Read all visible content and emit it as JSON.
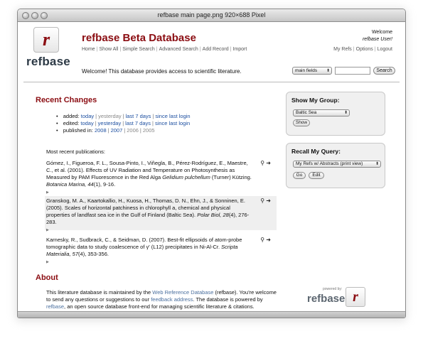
{
  "window": {
    "title": "refbase main page.png 920×688 Pixel"
  },
  "brand": {
    "logo_letter": "r",
    "logo_word": "refbase",
    "app_title": "refbase Beta Database"
  },
  "topnav": [
    "Home",
    "Show All",
    "Simple Search",
    "Advanced Search",
    "Add Record",
    "Import"
  ],
  "user": {
    "welcome": "Welcome",
    "name": "refbase User!",
    "nav": [
      "My Refs",
      "Options",
      "Logout"
    ]
  },
  "welcome_message": "Welcome! This database provides access to scientific literature.",
  "search": {
    "field_select": "main fields",
    "query": "",
    "button": "Search"
  },
  "recent_changes": {
    "heading": "Recent Changes",
    "added_label": "added:",
    "edited_label": "edited:",
    "published_label": "published in:",
    "today": "today",
    "yesterday": "yesterday",
    "last7": "last 7 days",
    "since_login": "since last login",
    "years": [
      "2008",
      "2007",
      "2006",
      "2005"
    ]
  },
  "publications": {
    "heading": "Most recent publications:",
    "items": [
      {
        "authors": "Gómez, I., Figueroa, F. L., Sousa-Pinto, I., Viñegla, B., Pérez-Rodríguez, E., Maestre, C., et al. (2001). Effects of UV Radiation and Temperature on Photosynthesis as Measured by PAM Fluorescence in the Red Alga ",
        "species": "Gelidium pulchellum",
        "rest": " (Turner) Kützing. ",
        "journal": "Botanica Marina, 44",
        "pages": "(1), 9-16."
      },
      {
        "authors": "Granskog, M. A., Kaartokallio, H., Kuosa, H., Thomas, D. N., Ehn, J., & Sonninen, E. (2005). Scales of horizontal patchiness in chlorophyll a, chemical and physical properties of landfast sea ice in the Gulf of Finland (Baltic Sea). ",
        "journal": "Polar Biol, 28",
        "pages": "(4), 276-283."
      },
      {
        "authors": "Karnesky, R., Sudbrack, C., & Seidman, D. (2007). Best-fit ellipsoids of atom-probe tomographic data to study coalescence of γ' (L12) precipitates in Ni-Al-Cr. ",
        "journal": "Scripta Materialia, 57",
        "pages": "(4), 353-356."
      }
    ]
  },
  "about": {
    "heading": "About",
    "t1": "This literature database is maintained by the ",
    "l1": "Web Reference Database",
    "t2": " (refbase). You're welcome to send any questions or suggestions to our ",
    "l2": "feedback address",
    "t3": ". The database is powered by ",
    "l3": "refbase",
    "t4": ", an open source database front-end for managing scientific literature & citations.",
    "powered_by": "powered by:"
  },
  "show_group": {
    "title": "Show My Group:",
    "selected": "Baltic Sea",
    "button": "Show"
  },
  "recall_query": {
    "title": "Recall My Query:",
    "selected": "My Refs w/ Abstracts (print view)",
    "go_button": "Go",
    "edit_button": "Edit"
  }
}
